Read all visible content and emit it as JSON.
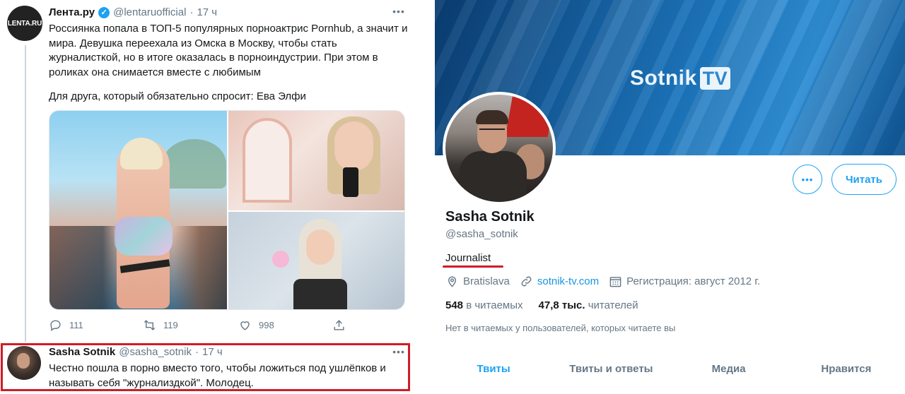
{
  "tweet_main": {
    "avatar_text": "LENTA.RU",
    "author": "Лента.ру",
    "handle": "@lentaruofficial",
    "separator": "·",
    "time": "17 ч",
    "more": "•••",
    "text": "Россиянка попала в ТОП-5 популярных порноактрис Pornhub, а значит и мира. Девушка переехала из Омска в Москву, чтобы стать журналисткой, но в итоге оказалась в порноиндустрии. При этом в роликах она снимается вместе с любимым",
    "text2": "Для друга, который обязательно спросит: Ева Элфи",
    "reply_count": "111",
    "retweet_count": "119",
    "like_count": "998"
  },
  "tweet_reply": {
    "author": "Sasha Sotnik",
    "handle": "@sasha_sotnik",
    "separator": "·",
    "time": "17 ч",
    "more": "•••",
    "text": "Честно пошла в порно вместо того, чтобы ложиться под ушлёпков и называть себя \"журнализдкой\". Молодец.",
    "highlight_color": "#d01c27"
  },
  "profile": {
    "banner_logo_text": "Sotnik",
    "banner_logo_badge": "TV",
    "more_button": "•••",
    "follow_button": "Читать",
    "name": "Sasha Sotnik",
    "handle": "@sasha_sotnik",
    "bio": "Journalist",
    "location": "Bratislava",
    "website": "sotnik-tv.com",
    "joined": "Регистрация: август 2012 г.",
    "following_count": "548",
    "following_label": "в читаемых",
    "followers_count": "47,8 тыс.",
    "followers_label": "читателей",
    "followed_by_note": "Нет в читаемых у пользователей, которых читаете вы",
    "tabs": [
      {
        "label": "Твиты",
        "active": true
      },
      {
        "label": "Твиты и ответы",
        "active": false
      },
      {
        "label": "Медиа",
        "active": false
      },
      {
        "label": "Нравится",
        "active": false
      }
    ]
  },
  "colors": {
    "accent": "#1da1f2",
    "link": "#1b95e0",
    "muted": "#657786",
    "highlight": "#d01c27"
  }
}
